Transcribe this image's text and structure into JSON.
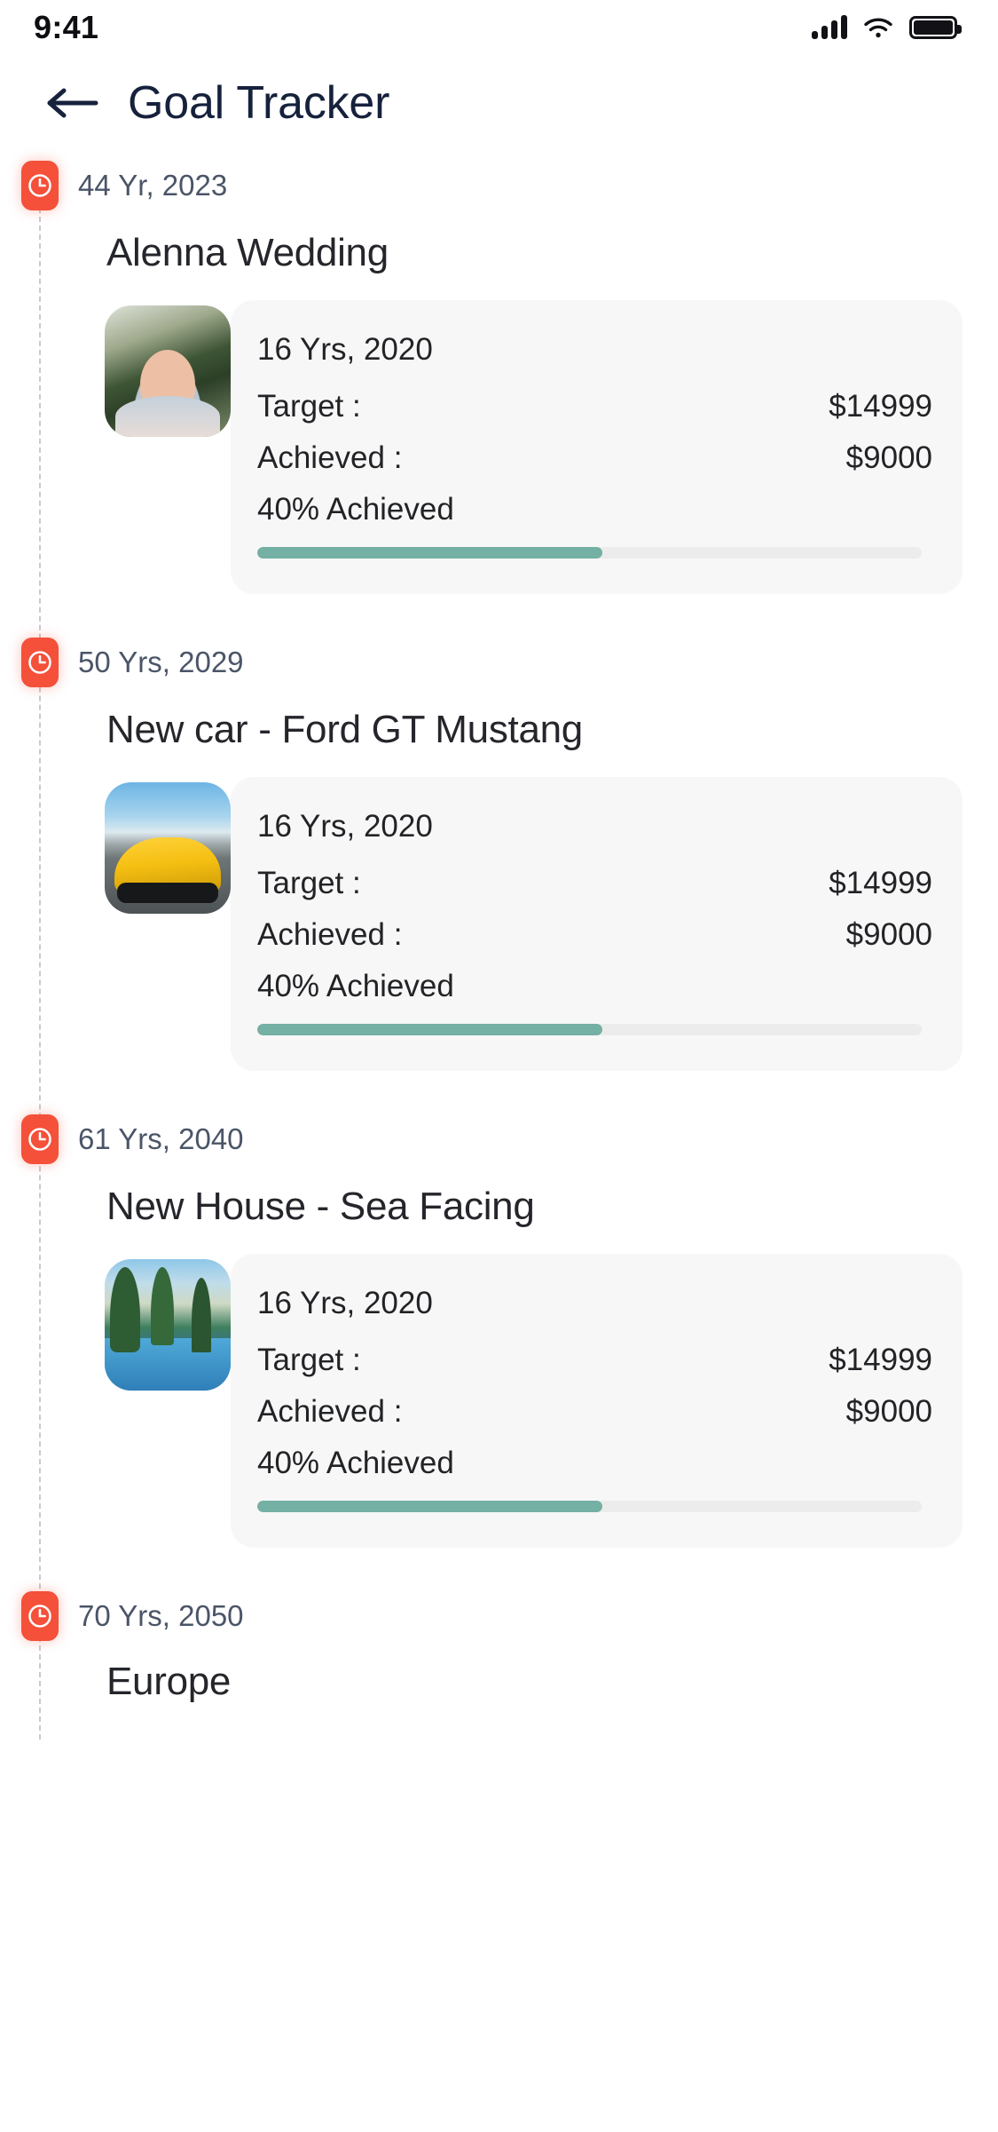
{
  "status_bar": {
    "time": "9:41",
    "icons": [
      "signal-icon",
      "wifi-icon",
      "battery-icon"
    ]
  },
  "header": {
    "back_icon": "arrow-left-icon",
    "title": "Goal Tracker",
    "title_color": "#16213c"
  },
  "theme": {
    "marker_color": "#f4503a",
    "progress_fill": "#74b0a4",
    "progress_track": "#ececec",
    "card_bg": "#f7f7f7",
    "timeline_line": "#c9c9cf"
  },
  "labels": {
    "target": "Target  :",
    "achieved": "Achieved :"
  },
  "timeline": {
    "entries": [
      {
        "marker_icon": "clock-icon",
        "date": "44 Yr, 2023",
        "title": "Alenna Wedding",
        "thumbnail": "girl-laughing-photo",
        "card": {
          "date": "16 Yrs, 2020",
          "target_label": "Target  :",
          "target_value": "$14999",
          "achieved_label": "Achieved :",
          "achieved_value": "$9000",
          "percent_text": "40% Achieved",
          "percent": 40,
          "bar_fill_ratio": 52
        }
      },
      {
        "marker_icon": "clock-icon",
        "date": "50 Yrs, 2029",
        "title": "New car - Ford GT Mustang",
        "thumbnail": "yellow-sports-car-photo",
        "card": {
          "date": "16 Yrs, 2020",
          "target_label": "Target  :",
          "target_value": "$14999",
          "achieved_label": "Achieved :",
          "achieved_value": "$9000",
          "percent_text": "40% Achieved",
          "percent": 40,
          "bar_fill_ratio": 52
        }
      },
      {
        "marker_icon": "clock-icon",
        "date": "61 Yrs, 2040",
        "title": "New House - Sea Facing",
        "thumbnail": "palm-pool-resort-photo",
        "card": {
          "date": "16 Yrs, 2020",
          "target_label": "Target  :",
          "target_value": "$14999",
          "achieved_label": "Achieved :",
          "achieved_value": "$9000",
          "percent_text": "40% Achieved",
          "percent": 40,
          "bar_fill_ratio": 52
        }
      },
      {
        "marker_icon": "clock-icon",
        "date": "70 Yrs, 2050",
        "title": "Europe",
        "thumbnail": "",
        "card": null
      }
    ]
  }
}
